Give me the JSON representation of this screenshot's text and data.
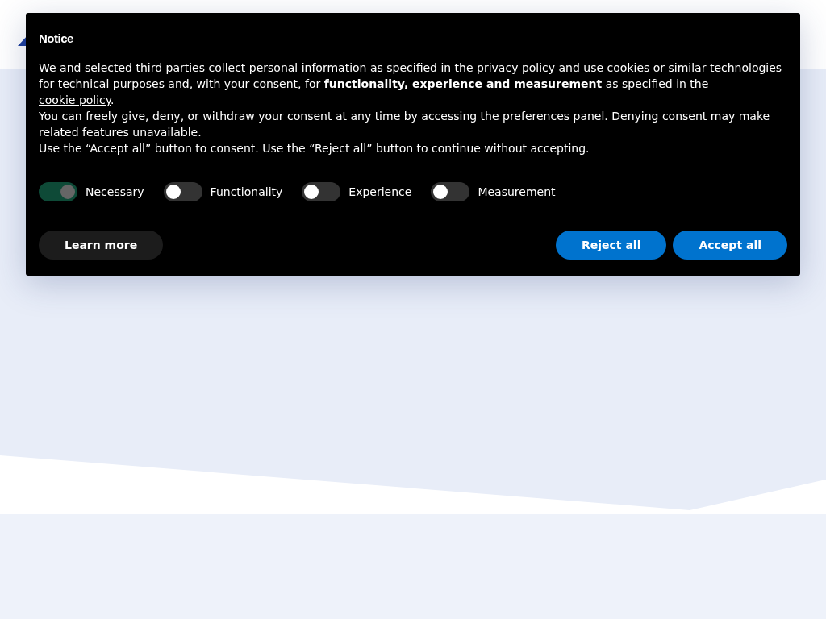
{
  "notice": {
    "title": "Notice",
    "paragraphs": [
      {
        "parts": [
          {
            "kind": "text",
            "text": "We and selected third parties collect personal information as specified in the "
          },
          {
            "kind": "link",
            "text": "privacy policy"
          },
          {
            "kind": "text",
            "text": " and use cookies or similar technologies for technical purposes and, with your consent, for **functionality, experience and measurement** as specified in the "
          },
          {
            "kind": "link",
            "text": "cookie policy"
          },
          {
            "kind": "text",
            "text": "."
          }
        ]
      },
      {
        "parts": [
          {
            "kind": "text",
            "text": "You can freely give, deny, or withdraw your consent at any time by accessing the preferences panel. Denying consent may make related features unavailable."
          }
        ]
      },
      {
        "parts": [
          {
            "kind": "text",
            "text": "Use the “Accept all” button to consent. Use the “Reject all” button to continue without accepting."
          }
        ]
      }
    ],
    "toggles": [
      {
        "label": "Necessary",
        "on": true,
        "disabled": true
      },
      {
        "label": "Functionality",
        "on": false,
        "disabled": false
      },
      {
        "label": "Experience",
        "on": false,
        "disabled": false
      },
      {
        "label": "Measurement",
        "on": false,
        "disabled": false
      }
    ],
    "buttons": [
      {
        "label": "Learn more",
        "kind": "secondary"
      },
      {
        "label": "Reject all",
        "kind": "primary"
      },
      {
        "label": "Accept all",
        "kind": "primary"
      }
    ]
  }
}
